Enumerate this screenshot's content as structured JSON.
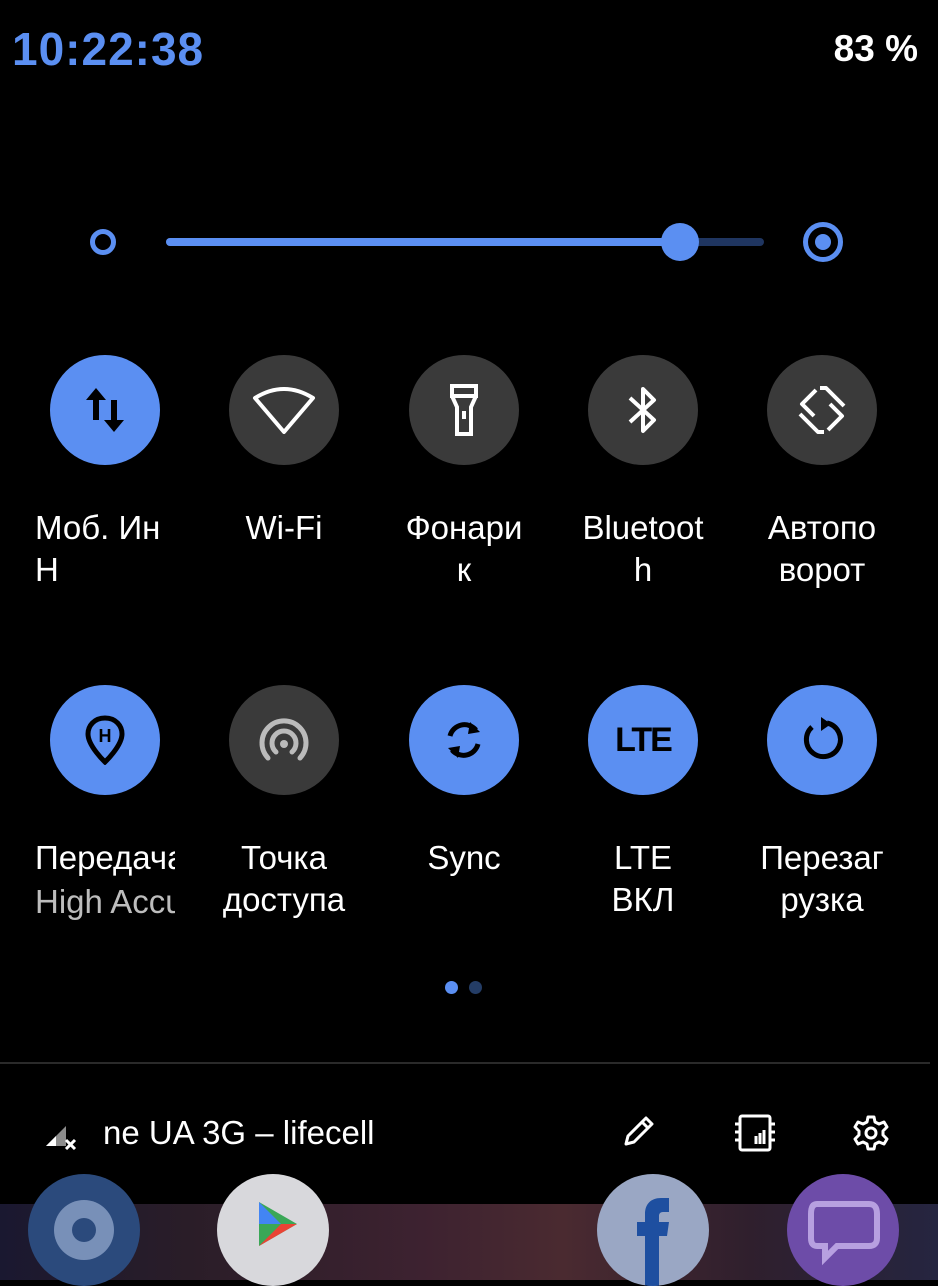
{
  "status_bar": {
    "clock": "10:22:38",
    "battery": "83 %"
  },
  "brightness": {
    "level": 0.86,
    "accent_color": "#5b8ff2"
  },
  "tiles": [
    {
      "label": "Моб. Ин\nН",
      "icon": "mobile-data-icon",
      "state": "on"
    },
    {
      "label": "Wi-Fi",
      "icon": "wifi-icon",
      "state": "off"
    },
    {
      "label": "Фонари\nк",
      "icon": "flashlight-icon",
      "state": "off"
    },
    {
      "label": "Bluetoot\nh",
      "icon": "bluetooth-icon",
      "state": "off"
    },
    {
      "label": "Автопо\nворот",
      "icon": "auto-rotate-icon",
      "state": "off"
    },
    {
      "label": "Передача",
      "sublabel": "High Accuracy",
      "icon": "location-icon",
      "state": "on"
    },
    {
      "label": "Точка\nдоступа",
      "icon": "hotspot-icon",
      "state": "off"
    },
    {
      "label": "Sync",
      "icon": "sync-icon",
      "state": "on"
    },
    {
      "label": "LTE\nВКЛ",
      "icon": "lte-icon",
      "icon_text": "LTE",
      "state": "on"
    },
    {
      "label": "Перезаг\nрузка",
      "icon": "restart-icon",
      "state": "on"
    }
  ],
  "page_indicator": {
    "pages": 2,
    "current": 1
  },
  "footer": {
    "carrier": "ne UA 3G – lifecell",
    "icons": [
      "no-signal-icon",
      "edit-icon",
      "sim-card-icon",
      "settings-icon"
    ]
  },
  "colors": {
    "accent": "#5b8ff2",
    "tile_off": "#3a3a3a",
    "background": "#000000"
  }
}
